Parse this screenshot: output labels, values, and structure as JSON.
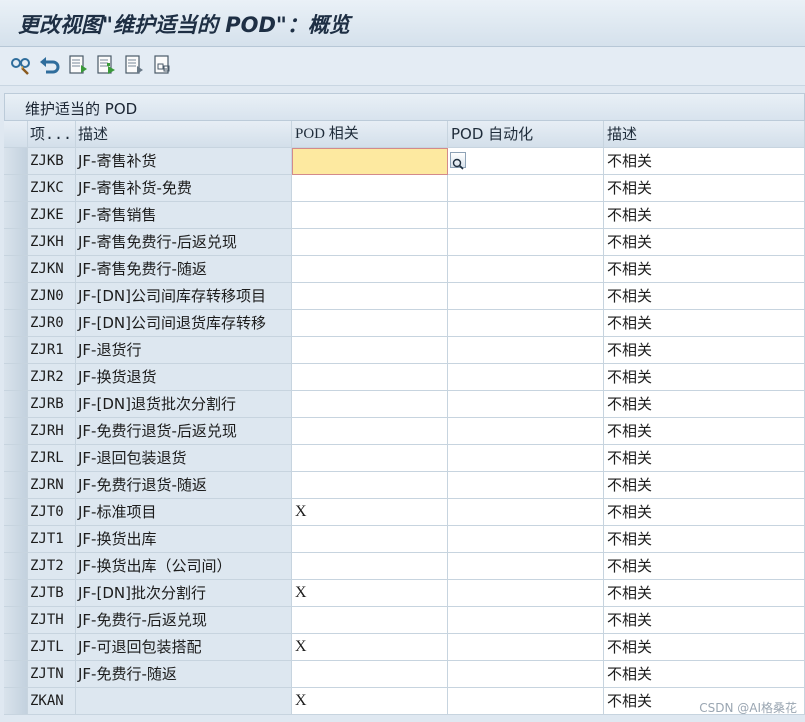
{
  "window": {
    "title": "更改视图\"维护适当的 POD\"：概览"
  },
  "toolbar": {
    "items": [
      {
        "icon": "glasses-display-change-icon"
      },
      {
        "icon": "undo-icon"
      },
      {
        "icon": "new-entries-icon"
      },
      {
        "icon": "copy-as-icon"
      },
      {
        "icon": "delete-icon"
      },
      {
        "icon": "select-all-icon"
      }
    ]
  },
  "section": {
    "label": "维护适当的 POD"
  },
  "table": {
    "headers": [
      "项...",
      "描述",
      "POD 相关",
      "POD 自动化",
      "描述"
    ],
    "rows": [
      {
        "code": "ZJKB",
        "desc": "JF-寄售补货",
        "pod": "",
        "auto": "",
        "note": "不相关"
      },
      {
        "code": "ZJKC",
        "desc": "JF-寄售补货-免费",
        "pod": "",
        "auto": "",
        "note": "不相关"
      },
      {
        "code": "ZJKE",
        "desc": "JF-寄售销售",
        "pod": "",
        "auto": "",
        "note": "不相关"
      },
      {
        "code": "ZJKH",
        "desc": "JF-寄售免费行-后返兑现",
        "pod": "",
        "auto": "",
        "note": "不相关"
      },
      {
        "code": "ZJKN",
        "desc": "JF-寄售免费行-随返",
        "pod": "",
        "auto": "",
        "note": "不相关"
      },
      {
        "code": "ZJN0",
        "desc": "JF-[DN]公司间库存转移项目",
        "pod": "",
        "auto": "",
        "note": "不相关"
      },
      {
        "code": "ZJR0",
        "desc": "JF-[DN]公司间退货库存转移",
        "pod": "",
        "auto": "",
        "note": "不相关"
      },
      {
        "code": "ZJR1",
        "desc": "JF-退货行",
        "pod": "",
        "auto": "",
        "note": "不相关"
      },
      {
        "code": "ZJR2",
        "desc": "JF-换货退货",
        "pod": "",
        "auto": "",
        "note": "不相关"
      },
      {
        "code": "ZJRB",
        "desc": "JF-[DN]退货批次分割行",
        "pod": "",
        "auto": "",
        "note": "不相关"
      },
      {
        "code": "ZJRH",
        "desc": "JF-免费行退货-后返兑现",
        "pod": "",
        "auto": "",
        "note": "不相关"
      },
      {
        "code": "ZJRL",
        "desc": "JF-退回包装退货",
        "pod": "",
        "auto": "",
        "note": "不相关"
      },
      {
        "code": "ZJRN",
        "desc": "JF-免费行退货-随返",
        "pod": "",
        "auto": "",
        "note": "不相关"
      },
      {
        "code": "ZJT0",
        "desc": "JF-标准项目",
        "pod": "X",
        "auto": "",
        "note": "不相关"
      },
      {
        "code": "ZJT1",
        "desc": "JF-换货出库",
        "pod": "",
        "auto": "",
        "note": "不相关"
      },
      {
        "code": "ZJT2",
        "desc": "JF-换货出库（公司间）",
        "pod": "",
        "auto": "",
        "note": "不相关"
      },
      {
        "code": "ZJTB",
        "desc": "JF-[DN]批次分割行",
        "pod": "X",
        "auto": "",
        "note": "不相关"
      },
      {
        "code": "ZJTH",
        "desc": "JF-免费行-后返兑现",
        "pod": "",
        "auto": "",
        "note": "不相关"
      },
      {
        "code": "ZJTL",
        "desc": "JF-可退回包装搭配",
        "pod": "X",
        "auto": "",
        "note": "不相关"
      },
      {
        "code": "ZJTN",
        "desc": "JF-免费行-随返",
        "pod": "",
        "auto": "",
        "note": "不相关"
      },
      {
        "code": "ZKAN",
        "desc": "",
        "pod": "X",
        "auto": "",
        "note": "不相关"
      }
    ]
  },
  "watermark": "CSDN @AI格桑花"
}
